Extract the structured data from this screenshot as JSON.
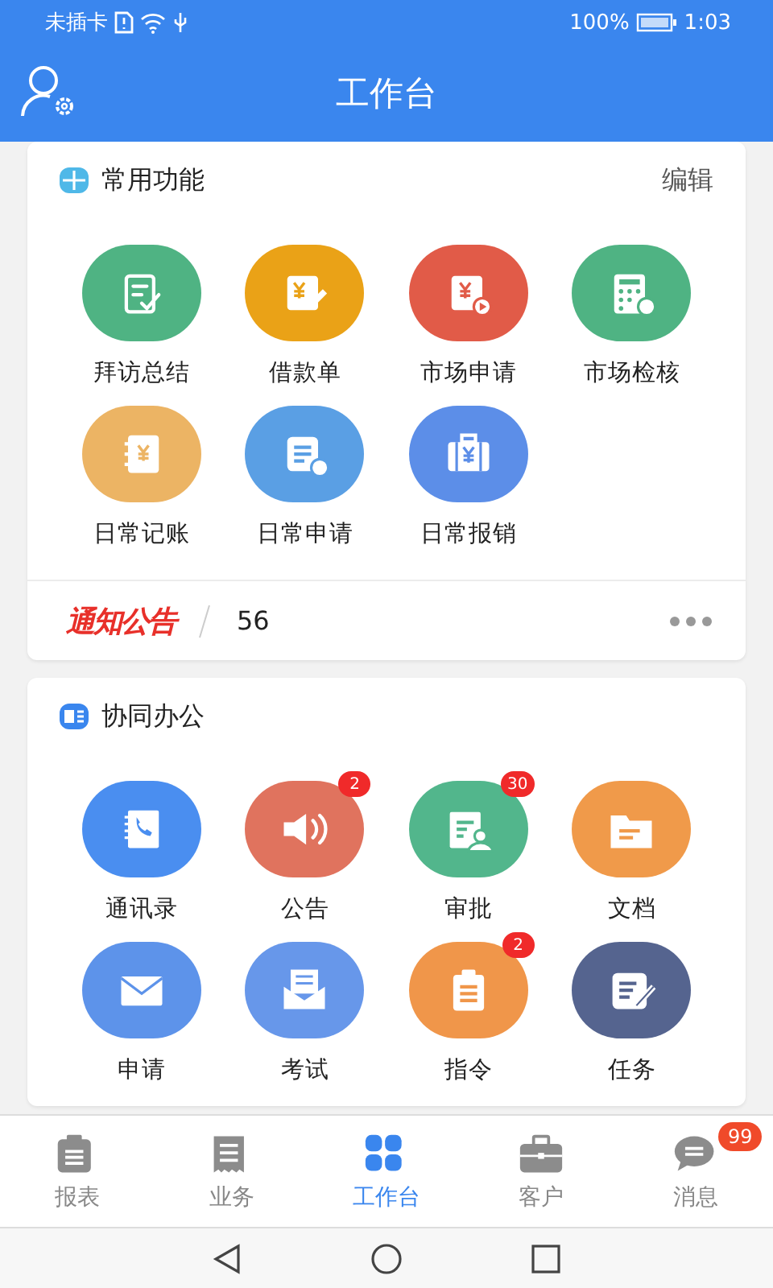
{
  "status_bar": {
    "carrier": "未插卡",
    "battery": "100%",
    "time": "1:03"
  },
  "header": {
    "title": "工作台"
  },
  "sections": [
    {
      "title": "常用功能",
      "action": "编辑",
      "items": [
        {
          "label": "拜访总结",
          "color": "#4fb383"
        },
        {
          "label": "借款单",
          "color": "#eaa217"
        },
        {
          "label": "市场申请",
          "color": "#e15b48"
        },
        {
          "label": "市场检核",
          "color": "#4fb383"
        },
        {
          "label": "日常记账",
          "color": "#ecb464"
        },
        {
          "label": "日常申请",
          "color": "#5a9fe4"
        },
        {
          "label": "日常报销",
          "color": "#5c8ee8"
        }
      ],
      "notice": {
        "title": "通知公告",
        "count": "56"
      }
    },
    {
      "title": "协同办公",
      "items": [
        {
          "label": "通讯录",
          "color": "#4a8ef0"
        },
        {
          "label": "公告",
          "color": "#e0735e",
          "badge": "2"
        },
        {
          "label": "审批",
          "color": "#52b68c",
          "badge": "30"
        },
        {
          "label": "文档",
          "color": "#f09a4a"
        },
        {
          "label": "申请",
          "color": "#5d93ea"
        },
        {
          "label": "考试",
          "color": "#6797ea"
        },
        {
          "label": "指令",
          "color": "#f0964a",
          "badge": "2"
        },
        {
          "label": "任务",
          "color": "#55648f"
        }
      ]
    }
  ],
  "tab_bar": [
    {
      "label": "报表",
      "selected": false
    },
    {
      "label": "业务",
      "selected": false
    },
    {
      "label": "工作台",
      "selected": true
    },
    {
      "label": "客户",
      "selected": false
    },
    {
      "label": "消息",
      "selected": false,
      "badge": "99"
    }
  ]
}
